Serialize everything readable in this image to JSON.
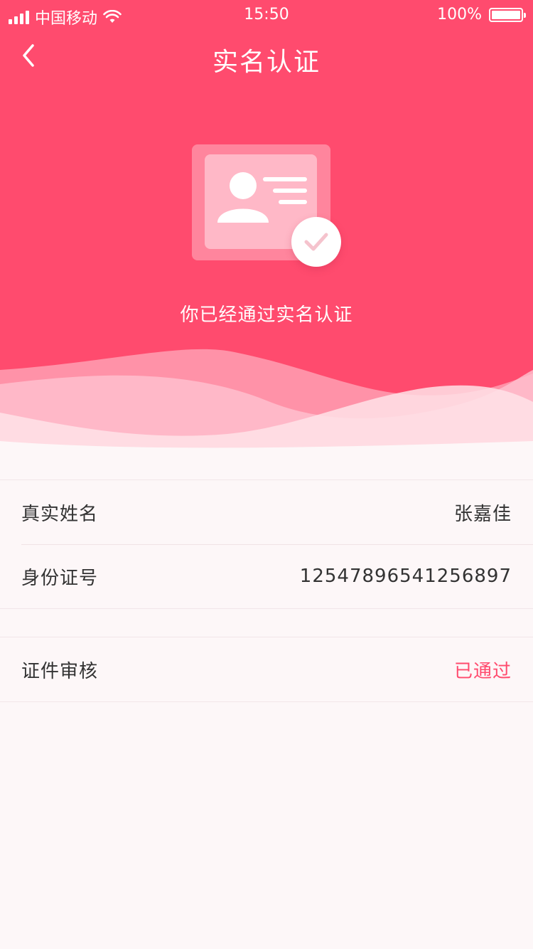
{
  "status_bar": {
    "carrier": "中国移动",
    "time": "15:50",
    "battery": "100%"
  },
  "nav": {
    "title": "实名认证",
    "back_icon": "chevron-left-icon"
  },
  "hero": {
    "message": "你已经通过实名认证",
    "illustration_icon": "id-card-verified-icon"
  },
  "info": {
    "rows": [
      {
        "label": "真实姓名",
        "value": "张嘉佳"
      },
      {
        "label": "身份证号",
        "value": "12547896541256897"
      }
    ],
    "review": {
      "label": "证件审核",
      "value": "已通过"
    }
  },
  "colors": {
    "brand": "#ff4b6e",
    "background": "#fdf7f8",
    "text": "#333333"
  }
}
